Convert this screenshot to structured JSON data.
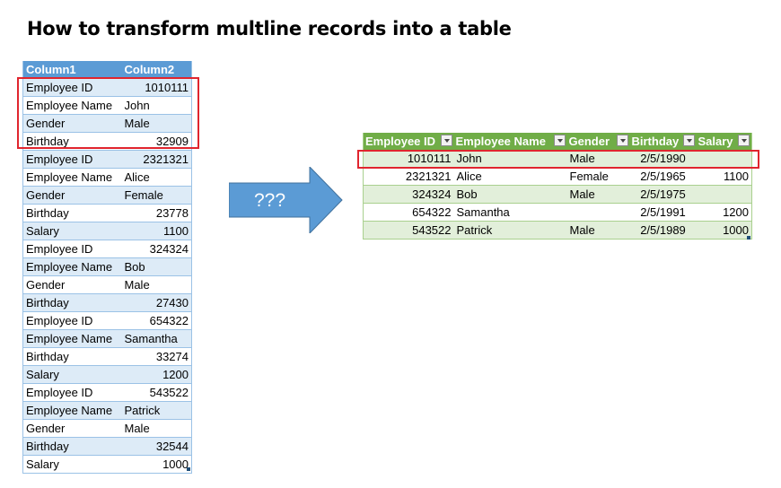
{
  "title": "How to transform multline records into a table",
  "arrow_label": "???",
  "colors": {
    "blue_header": "#5b9bd5",
    "blue_band": "#ddebf7",
    "green_header": "#70ad47",
    "green_band": "#e2efda",
    "highlight": "#e0252e",
    "arrow": "#5b9bd5"
  },
  "left_table": {
    "headers": [
      "Column1",
      "Column2"
    ],
    "rows": [
      [
        "Employee ID",
        "1010111"
      ],
      [
        "Employee Name",
        "John"
      ],
      [
        "Gender",
        "Male"
      ],
      [
        "Birthday",
        "32909"
      ],
      [
        "Employee ID",
        "2321321"
      ],
      [
        "Employee Name",
        "Alice"
      ],
      [
        "Gender",
        "Female"
      ],
      [
        "Birthday",
        "23778"
      ],
      [
        "Salary",
        "1100"
      ],
      [
        "Employee ID",
        "324324"
      ],
      [
        "Employee Name",
        "Bob"
      ],
      [
        "Gender",
        "Male"
      ],
      [
        "Birthday",
        "27430"
      ],
      [
        "Employee ID",
        "654322"
      ],
      [
        "Employee Name",
        "Samantha"
      ],
      [
        "Birthday",
        "33274"
      ],
      [
        "Salary",
        "1200"
      ],
      [
        "Employee ID",
        "543522"
      ],
      [
        "Employee Name",
        "Patrick"
      ],
      [
        "Gender",
        "Male"
      ],
      [
        "Birthday",
        "32544"
      ],
      [
        "Salary",
        "1000"
      ]
    ]
  },
  "right_table": {
    "headers": [
      "Employee ID",
      "Employee Name",
      "Gender",
      "Birthday",
      "Salary"
    ],
    "rows": [
      [
        "1010111",
        "John",
        "Male",
        "2/5/1990",
        ""
      ],
      [
        "2321321",
        "Alice",
        "Female",
        "2/5/1965",
        "1100"
      ],
      [
        "324324",
        "Bob",
        "Male",
        "2/5/1975",
        ""
      ],
      [
        "654322",
        "Samantha",
        "",
        "2/5/1991",
        "1200"
      ],
      [
        "543522",
        "Patrick",
        "Male",
        "2/5/1989",
        "1000"
      ]
    ]
  }
}
